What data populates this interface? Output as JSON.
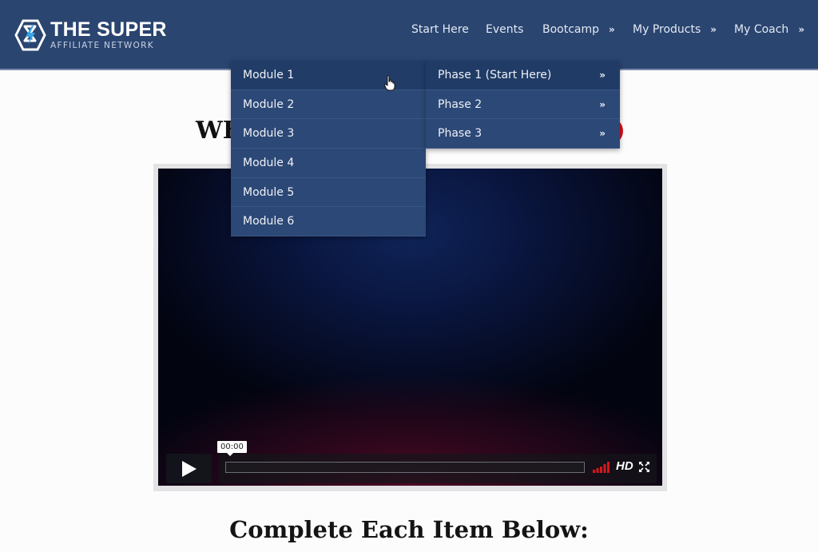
{
  "brand": {
    "title": "THE SUPER",
    "subtitle": "AFFILIATE NETWORK",
    "icon": "lightning-bolt-logo-icon"
  },
  "nav": {
    "items": [
      {
        "label": "Start Here",
        "has_submenu": false
      },
      {
        "label": "Events",
        "has_submenu": false
      },
      {
        "label": "Bootcamp",
        "has_submenu": true
      },
      {
        "label": "My Products",
        "has_submenu": true
      },
      {
        "label": "My Coach",
        "has_submenu": true
      }
    ],
    "submenu_glyph": "»"
  },
  "dropdown": {
    "items": [
      "Module 1",
      "Module 2",
      "Module 3",
      "Module 4",
      "Module 5",
      "Module 6"
    ],
    "active_index": 0
  },
  "submenu": {
    "items": [
      {
        "label": "Phase 1 (Start Here)",
        "chev": "»"
      },
      {
        "label": "Phase 2",
        "chev": "»"
      },
      {
        "label": "Phase 3",
        "chev": "»"
      }
    ],
    "active_index": 0
  },
  "page": {
    "welcome_partial": "WE",
    "section_title": "Complete Each Item Below:"
  },
  "video": {
    "time": "00:00",
    "quality_label": "HD",
    "progress": 0,
    "icons": [
      "play-icon",
      "volume-icon",
      "fullscreen-icon"
    ]
  },
  "colors": {
    "header_bg": "#2a4570",
    "menu_bg": "#2c4876",
    "accent_red": "#d20f1a"
  }
}
